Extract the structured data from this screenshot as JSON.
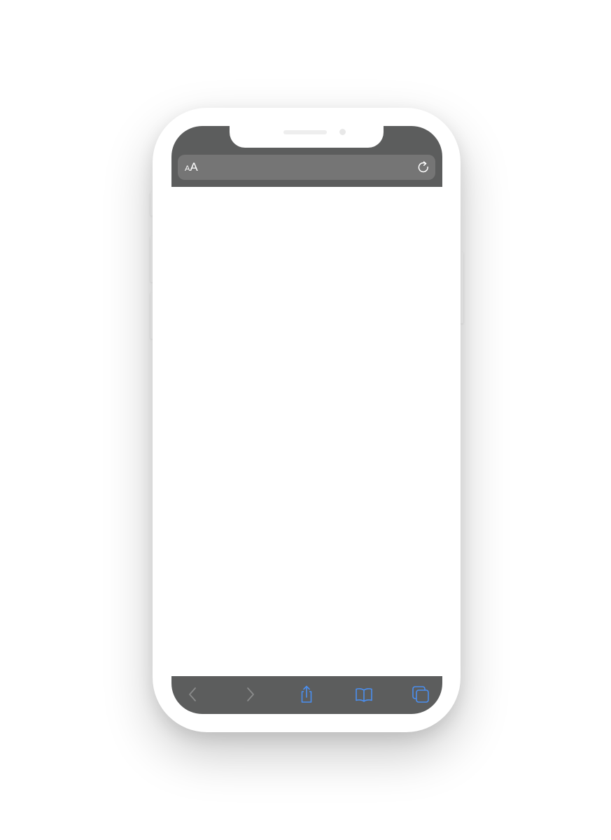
{
  "browser": {
    "address_bar": {
      "text_size_small": "A",
      "text_size_large": "A",
      "reload_icon": "reload-icon"
    },
    "toolbar": {
      "back_icon": "chevron-left-icon",
      "forward_icon": "chevron-right-icon",
      "share_icon": "share-icon",
      "bookmarks_icon": "book-icon",
      "tabs_icon": "tabs-icon"
    }
  },
  "colors": {
    "chrome": "#5c5d5d",
    "address_bar": "#757575",
    "accent": "#4a8ff0",
    "disabled": "#8a8b8b"
  }
}
